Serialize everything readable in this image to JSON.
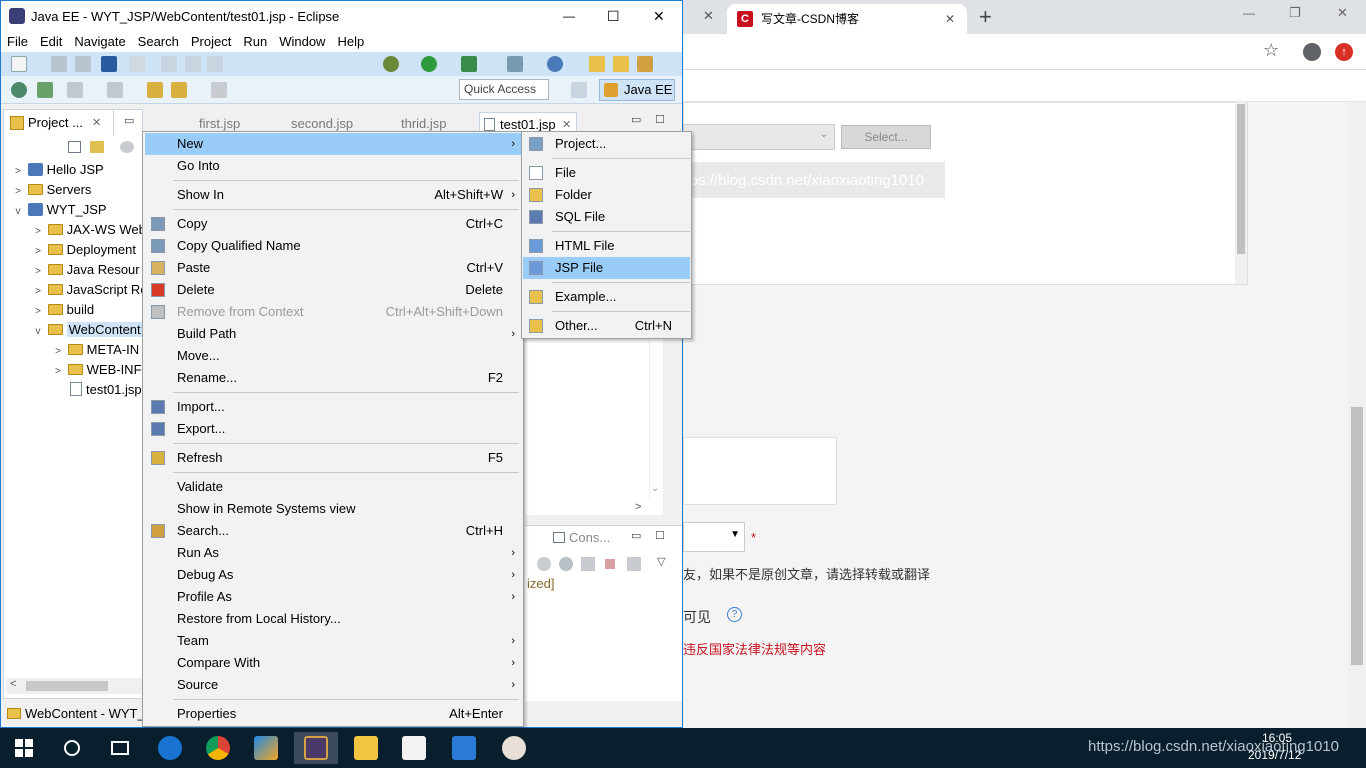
{
  "browser": {
    "tabs": [
      {
        "title": ""
      },
      {
        "title": "写文章-CSDN博客"
      }
    ],
    "new_tab": "+",
    "window_controls": {
      "minimize": "—",
      "maximize": "❐",
      "close": "✕"
    },
    "content": {
      "select_button": "Select...",
      "watermark": "https://blog.csdn.net/xiaoxiaoting1010",
      "required_mark": "*",
      "original_notice": "友，如果不是原创文章，请选择转载或翻译",
      "visibility": "可见",
      "legal_notice": "违反国家法律法规等内容"
    }
  },
  "eclipse": {
    "title": "Java EE - WYT_JSP/WebContent/test01.jsp - Eclipse",
    "window_controls": {
      "minimize": "—",
      "maximize": "☐",
      "close": "✕"
    },
    "menu": [
      "File",
      "Edit",
      "Navigate",
      "Search",
      "Project",
      "Run",
      "Window",
      "Help"
    ],
    "quick_access": "Quick Access",
    "perspective": "Java EE",
    "project_explorer": {
      "tab_label": "Project ...",
      "tree": [
        {
          "label": "Hello JSP",
          "indent": 0,
          "twisty": ">",
          "icon": "project"
        },
        {
          "label": "Servers",
          "indent": 0,
          "twisty": ">",
          "icon": "folder"
        },
        {
          "label": "WYT_JSP",
          "indent": 0,
          "twisty": "v",
          "icon": "project"
        },
        {
          "label": "JAX-WS Web",
          "indent": 1,
          "twisty": ">",
          "icon": "folder"
        },
        {
          "label": "Deployment",
          "indent": 1,
          "twisty": ">",
          "icon": "folder"
        },
        {
          "label": "Java Resour",
          "indent": 1,
          "twisty": ">",
          "icon": "folder"
        },
        {
          "label": "JavaScript Re",
          "indent": 1,
          "twisty": ">",
          "icon": "folder"
        },
        {
          "label": "build",
          "indent": 1,
          "twisty": ">",
          "icon": "folder"
        },
        {
          "label": "WebContent",
          "indent": 1,
          "twisty": "v",
          "icon": "folder"
        },
        {
          "label": "META-IN",
          "indent": 2,
          "twisty": ">",
          "icon": "folder"
        },
        {
          "label": "WEB-INF",
          "indent": 2,
          "twisty": ">",
          "icon": "folder"
        },
        {
          "label": "test01.jsp",
          "indent": 2,
          "twisty": "",
          "icon": "file"
        }
      ]
    },
    "editor_tabs": [
      "first.jsp",
      "second.jsp",
      "thrid.jsp",
      "test01.jsp"
    ],
    "console_tab": "Cons...",
    "console_text": "ized]",
    "status_bar": "WebContent - WYT_"
  },
  "context_menu": {
    "items": [
      {
        "label": "New",
        "shortcut": "",
        "submenu": true,
        "highlight": true
      },
      {
        "label": "Go Into",
        "shortcut": ""
      },
      {
        "sep": true
      },
      {
        "label": "Show In",
        "shortcut": "Alt+Shift+W",
        "submenu": true
      },
      {
        "sep": true
      },
      {
        "label": "Copy",
        "shortcut": "Ctrl+C",
        "icon": "copy"
      },
      {
        "label": "Copy Qualified Name",
        "shortcut": "",
        "icon": "copy"
      },
      {
        "label": "Paste",
        "shortcut": "Ctrl+V",
        "icon": "paste"
      },
      {
        "label": "Delete",
        "shortcut": "Delete",
        "icon": "delete"
      },
      {
        "label": "Remove from Context",
        "shortcut": "Ctrl+Alt+Shift+Down",
        "disabled": true,
        "icon": "remove"
      },
      {
        "label": "Build Path",
        "shortcut": "",
        "submenu": true
      },
      {
        "label": "Move...",
        "shortcut": ""
      },
      {
        "label": "Rename...",
        "shortcut": "F2"
      },
      {
        "sep": true
      },
      {
        "label": "Import...",
        "shortcut": "",
        "icon": "import"
      },
      {
        "label": "Export...",
        "shortcut": "",
        "icon": "export"
      },
      {
        "sep": true
      },
      {
        "label": "Refresh",
        "shortcut": "F5",
        "icon": "refresh"
      },
      {
        "sep": true
      },
      {
        "label": "Validate",
        "shortcut": ""
      },
      {
        "label": "Show in Remote Systems view",
        "shortcut": ""
      },
      {
        "label": "Search...",
        "shortcut": "Ctrl+H",
        "icon": "search"
      },
      {
        "label": "Run As",
        "shortcut": "",
        "submenu": true
      },
      {
        "label": "Debug As",
        "shortcut": "",
        "submenu": true
      },
      {
        "label": "Profile As",
        "shortcut": "",
        "submenu": true
      },
      {
        "label": "Restore from Local History...",
        "shortcut": ""
      },
      {
        "label": "Team",
        "shortcut": "",
        "submenu": true
      },
      {
        "label": "Compare With",
        "shortcut": "",
        "submenu": true
      },
      {
        "label": "Source",
        "shortcut": "",
        "submenu": true
      },
      {
        "sep": true
      },
      {
        "label": "Properties",
        "shortcut": "Alt+Enter"
      }
    ]
  },
  "new_submenu": {
    "items": [
      {
        "label": "Project...",
        "shortcut": "",
        "icon": "project"
      },
      {
        "sep": true
      },
      {
        "label": "File",
        "shortcut": "",
        "icon": "file"
      },
      {
        "label": "Folder",
        "shortcut": "",
        "icon": "folder"
      },
      {
        "label": "SQL File",
        "shortcut": "",
        "icon": "sql"
      },
      {
        "sep": true
      },
      {
        "label": "HTML File",
        "shortcut": "",
        "icon": "html"
      },
      {
        "label": "JSP File",
        "shortcut": "",
        "icon": "jsp",
        "highlight": true
      },
      {
        "sep": true
      },
      {
        "label": "Example...",
        "shortcut": "",
        "icon": "example"
      },
      {
        "sep": true
      },
      {
        "label": "Other...",
        "shortcut": "Ctrl+N",
        "icon": "other"
      }
    ]
  },
  "taskbar": {
    "clock_time": "16:05",
    "clock_date": "2019/7/12",
    "tray_text": "https://blog.csdn.net/xiaoxiaoting1010"
  }
}
